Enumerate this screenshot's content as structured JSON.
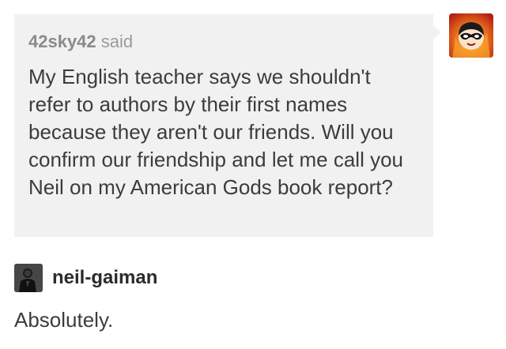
{
  "ask": {
    "asker_name": "42sky42",
    "said_label": "said",
    "question": "My English teacher says we shouldn't refer to authors by their first names because they aren't our friends. Will you confirm our friendship and let me call you Neil on my American Gods book report?"
  },
  "answer": {
    "answerer_name": "neil-gaiman",
    "text": "Absolutely."
  },
  "colors": {
    "ask_background": "#f1f1f1",
    "asker_avatar_fire": "#e8491d",
    "text_dark": "#3c3c3c",
    "text_muted": "#9b9b9b"
  }
}
